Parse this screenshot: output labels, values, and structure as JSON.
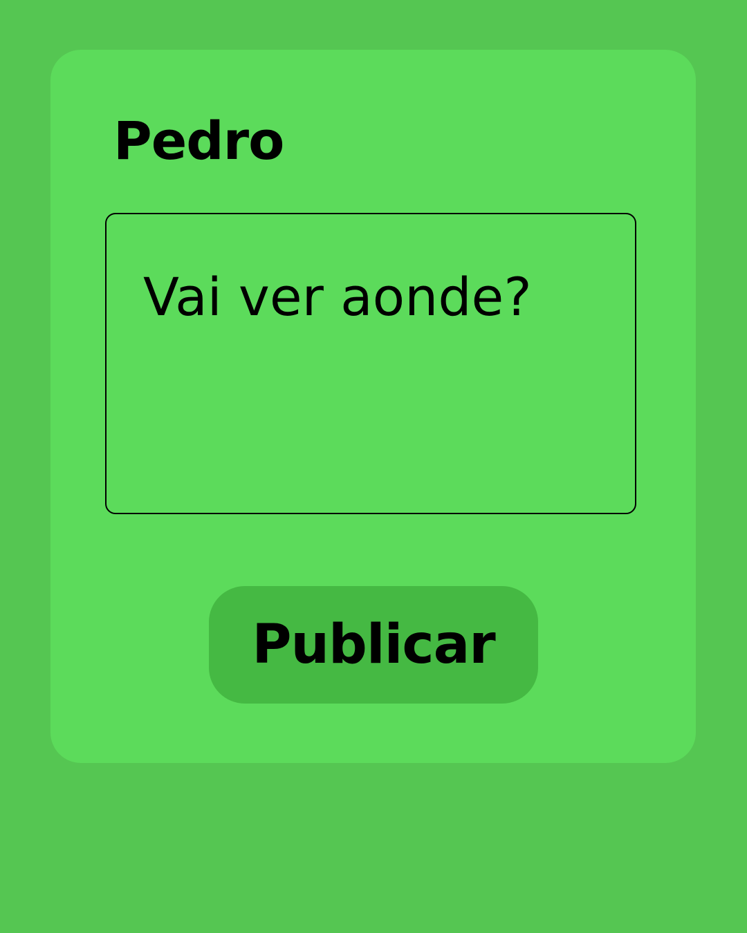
{
  "post_card": {
    "author_name": "Pedro",
    "text": "Vai ver aonde?",
    "publish_label": "Publicar"
  },
  "colors": {
    "background": "#55c652",
    "card": "#5cdb5b",
    "button": "#45b943",
    "text": "#000000"
  }
}
